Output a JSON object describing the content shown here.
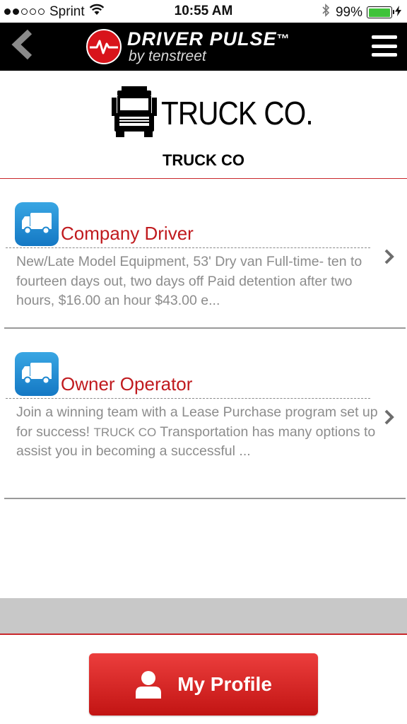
{
  "status_bar": {
    "carrier": "Sprint",
    "time": "10:55 AM",
    "battery_percent": "99%",
    "battery_level": 0.99,
    "signal_dots_filled": 2,
    "signal_dots_total": 5
  },
  "header": {
    "brand_name": "DRIVER PULSE",
    "brand_tm": "™",
    "brand_sub": "by tenstreet",
    "back_icon": "chevron-left-icon",
    "menu_icon": "hamburger-menu-icon"
  },
  "company": {
    "logo_text": "TRUCK CO.",
    "name": "TRUCK CO"
  },
  "jobs": [
    {
      "title": "Company Driver",
      "description": "New/Late Model Equipment, 53' Dry van Full-time- ten to fourteen days out, two days off Paid detention after two hours, $16.00 an hour $43.00 e...",
      "icon": "truck-icon"
    },
    {
      "title": "Owner Operator",
      "description_before": "Join a winning team with a Lease Purchase program set up for success! ",
      "description_company": "TRUCK CO",
      "description_after": " Transportation has many options to assist you in becoming a successful ...",
      "icon": "truck-icon"
    }
  ],
  "footer": {
    "profile_label": "My Profile",
    "profile_icon": "user-icon"
  },
  "colors": {
    "brand_red": "#c01a1e",
    "header_bg": "#000000",
    "icon_blue": "#1e88d0",
    "button_red": "#d62a29",
    "band_gray": "#c8c8c8"
  }
}
